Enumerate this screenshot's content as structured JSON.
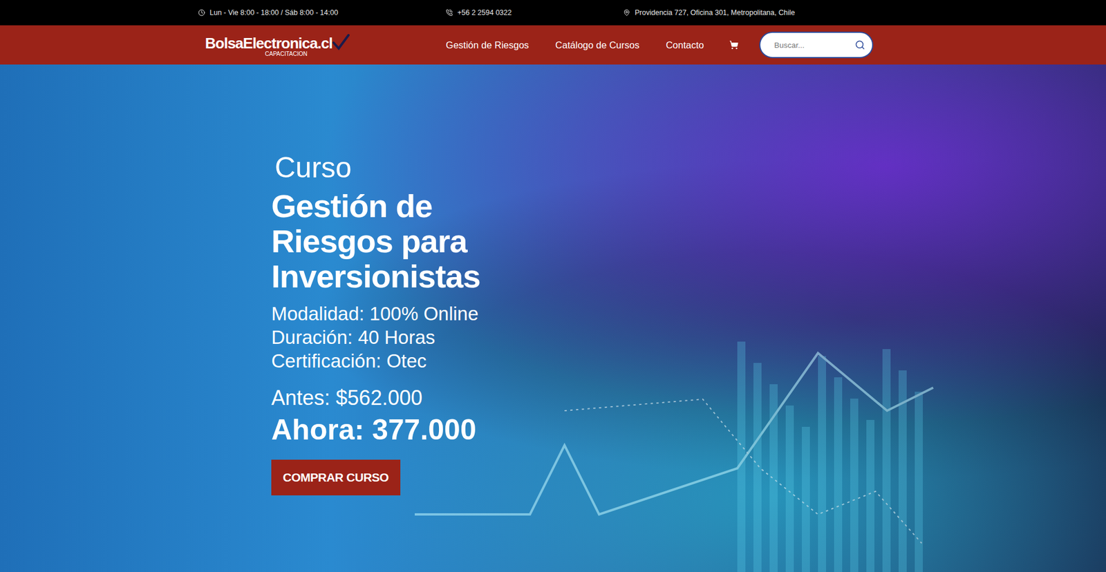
{
  "top_bar": [
    {
      "text": "Lun - Vie 8:00 - 18:00 / Sáb 8:00 - 14:00"
    },
    {
      "text": "+56 2 2594 0322"
    },
    {
      "text": "Providencia 727, Oficina 301, Metropolitana, Chile"
    }
  ],
  "logo": {
    "name": "BolsaElectronica.cl",
    "tagline": "CAPACITACION"
  },
  "nav": [
    {
      "label": "Gestión de Riesgos",
      "selected": false
    },
    {
      "label": "Catálogo de Cursos",
      "selected": false
    },
    {
      "label": "Contacto",
      "selected": false
    }
  ],
  "search": {
    "placeholder": "Buscar..."
  },
  "hero": {
    "eyebrow": "Curso",
    "title": [
      "Gestión de",
      "Riesgos para",
      "Inversionistas"
    ],
    "details": [
      "Modalidad: 100% Online",
      "Duración: 40 Horas",
      "Certificación: Otec"
    ],
    "old_price": "Antes: $562.000",
    "new_price": "Ahora: 377.000",
    "button": "COMPRAR CURSO"
  }
}
